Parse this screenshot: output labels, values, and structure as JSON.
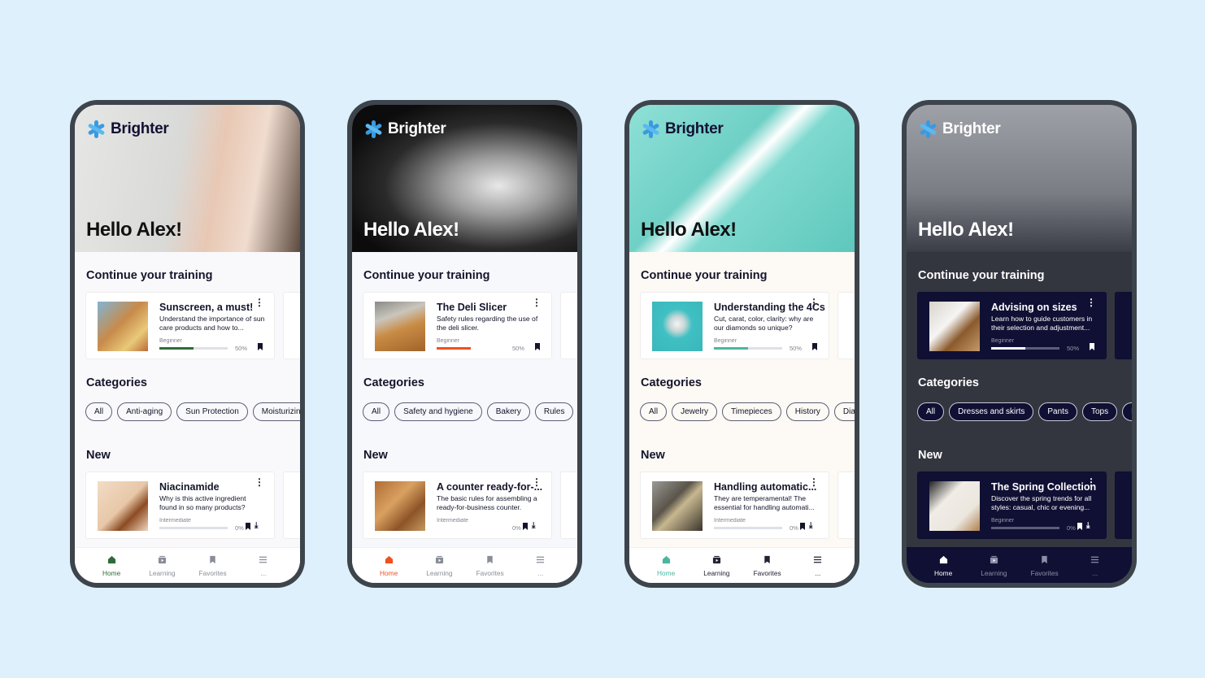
{
  "app_name": "Brighter",
  "phones": [
    {
      "theme": {
        "bg": "#f9f9fb",
        "card": "#ffffff",
        "text": "#14152b",
        "accent": "#2e6b3a",
        "track": "#dde0e6",
        "chip": "#5b5e75",
        "nav": "#ffffff",
        "navText": "#8a8d99",
        "hero": "linear-gradient(100deg,#e6e7e5 0%,#d9dad8 45%,#e8c8b4 62%,#f0dccf 78%,#5c4a3f 100%)",
        "helloColor": "#111111",
        "logoColor": "#111133",
        "thumb1": "linear-gradient(135deg,#7fb5d6,#c88a4a 45%,#e9c97a 75%,#b86c3a)",
        "thumb2": "linear-gradient(135deg,#f3dcc4,#e7c7a8 50%,#8b4b22 70%,#f0d6bd)"
      },
      "greeting": "Hello Alex!",
      "continue_title": "Continue your training",
      "continue_card": {
        "title": "Sunscreen, a must!",
        "desc": "Understand the importance of sun care products and how to...",
        "level": "Beginner",
        "progress": 50,
        "percent_label": "50%"
      },
      "categories_title": "Categories",
      "categories": [
        "All",
        "Anti-aging",
        "Sun Protection",
        "Moisturizing"
      ],
      "new_title": "New",
      "new_card": {
        "title": "Niacinamide",
        "desc": "Why is this active ingredient found in so many products?",
        "level": "Intermediate",
        "progress": 0,
        "percent_label": "0%"
      },
      "nav": [
        {
          "label": "Home",
          "icon": "home-icon",
          "active": true
        },
        {
          "label": "Learning",
          "icon": "learning-icon"
        },
        {
          "label": "Favorites",
          "icon": "bookmark-icon"
        },
        {
          "label": "...",
          "icon": "menu-icon"
        }
      ]
    },
    {
      "theme": {
        "bg": "#f6f8fc",
        "card": "#ffffff",
        "text": "#14152b",
        "accent": "#f0501e",
        "track": "#ffffff",
        "chip": "#5b5e75",
        "nav": "#ffffff",
        "navText": "#8a8d99",
        "hero": "radial-gradient(ellipse at 65% 55%,#e8e8e8 0%,#9c9c9c 25%,#2a2a2a 55%,#0c0c0c 80%)",
        "helloColor": "#ffffff",
        "logoColor": "#ffffff",
        "thumb1": "linear-gradient(160deg,#8a8a86,#c9c6bd 30%,#c98c45 55%,#a0642a)",
        "thumb2": "linear-gradient(135deg,#b06d35,#d9a160 40%,#8d5428 70%,#c49a5f)"
      },
      "greeting": "Hello Alex!",
      "continue_title": "Continue your training",
      "continue_card": {
        "title": "The Deli Slicer",
        "desc": "Safety rules regarding the use of the deli slicer.",
        "level": "Beginner",
        "progress": 50,
        "percent_label": "50%"
      },
      "categories_title": "Categories",
      "categories": [
        "All",
        "Safety and hygiene",
        "Bakery",
        "Rules"
      ],
      "new_title": "New",
      "new_card": {
        "title": "A counter ready-for-...",
        "desc": "The basic rules for assembling a ready-for-business counter.",
        "level": "Intermediate",
        "progress": 0,
        "percent_label": "0%"
      },
      "nav": [
        {
          "label": "Home",
          "icon": "home-icon",
          "active": true
        },
        {
          "label": "Learning",
          "icon": "learning-icon"
        },
        {
          "label": "Favorites",
          "icon": "bookmark-icon"
        },
        {
          "label": "...",
          "icon": "menu-icon"
        }
      ]
    },
    {
      "theme": {
        "bg": "#fdf9f4",
        "card": "#ffffff",
        "text": "#14152b",
        "accent": "#4bb5a0",
        "track": "#dde0e6",
        "chip": "#5b5e75",
        "nav": "#ffffff",
        "navText": "#222233",
        "hero": "linear-gradient(135deg,#8fe0d6 0%,#6fd0c6 40%,#ffffff 48%,#7fd9cf 56%,#5ec7bc 100%)",
        "helloColor": "#111111",
        "logoColor": "#111133",
        "thumb1": "radial-gradient(circle at 50% 45%,#f4f4f4 0%,#c8d6d6 20%,#3fc0c3 40%,#3bb6ba 100%)",
        "thumb2": "linear-gradient(135deg,#9a9a94,#5a544a 40%,#c8b890 55%,#3a342c)"
      },
      "greeting": "Hello Alex!",
      "continue_title": "Continue your training",
      "continue_card": {
        "title": "Understanding the 4Cs",
        "desc": "Cut, carat, color, clarity: why are our diamonds so unique?",
        "level": "Beginner",
        "progress": 50,
        "percent_label": "50%"
      },
      "categories_title": "Categories",
      "categories": [
        "All",
        "Jewelry",
        "Timepieces",
        "History",
        "Diamonds"
      ],
      "new_title": "New",
      "new_card": {
        "title": "Handling automatic...",
        "desc": "They are temperamental! The essential for handling automati...",
        "level": "Intermediate",
        "progress": 0,
        "percent_label": "0%"
      },
      "nav": [
        {
          "label": "Home",
          "icon": "home-icon",
          "active": true
        },
        {
          "label": "Learning",
          "icon": "learning-icon"
        },
        {
          "label": "Favorites",
          "icon": "bookmark-icon"
        },
        {
          "label": "...",
          "icon": "menu-icon"
        }
      ]
    },
    {
      "theme": {
        "bg": "#33353f",
        "card": "#0f1033",
        "text": "#ffffff",
        "accent": "#ffffff",
        "track": "#5c5e78",
        "chip": "#c9cad6",
        "chipBg": "#0f1033",
        "nav": "#0f1033",
        "navText": "#8d8fa8",
        "hero": "linear-gradient(180deg,#9fa1a8 0%,#7b7d85 60%,#3a3c46 100%)",
        "helloColor": "#ffffff",
        "logoColor": "#ffffff",
        "thumb1": "linear-gradient(135deg,#d9d3c9,#f5f5f5 40%,#8a5a2c 65%,#c49a6b)",
        "thumb2": "linear-gradient(135deg,#222,#f0ece6 35%,#ebe6de 70%,#b08050)"
      },
      "greeting": "Hello Alex!",
      "continue_title": "Continue your training",
      "continue_card": {
        "title": "Advising on sizes",
        "desc": "Learn how to guide customers in their selection and adjustment...",
        "level": "Beginner",
        "progress": 50,
        "percent_label": "50%"
      },
      "categories_title": "Categories",
      "categories": [
        "All",
        "Dresses and skirts",
        "Pants",
        "Tops",
        "F"
      ],
      "new_title": "New",
      "new_card": {
        "title": "The Spring Collection",
        "desc": "Discover the spring trends for all styles: casual, chic or evening...",
        "level": "Beginner",
        "progress": 0,
        "percent_label": "0%"
      },
      "nav": [
        {
          "label": "Home",
          "icon": "home-icon",
          "active": true
        },
        {
          "label": "Learning",
          "icon": "learning-icon"
        },
        {
          "label": "Favorites",
          "icon": "bookmark-icon"
        },
        {
          "label": "...",
          "icon": "menu-icon"
        }
      ]
    }
  ]
}
